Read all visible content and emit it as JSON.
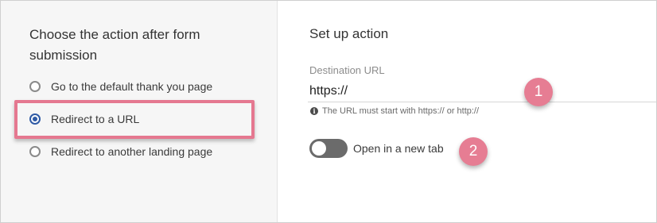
{
  "left_panel": {
    "title": "Choose the action after form submission",
    "options": [
      {
        "label": "Go to the default thank you page",
        "selected": false
      },
      {
        "label": "Redirect to a URL",
        "selected": true
      },
      {
        "label": "Redirect to another landing page",
        "selected": false
      }
    ]
  },
  "right_panel": {
    "title": "Set up action",
    "destination_label": "Destination URL",
    "destination_value": "https://",
    "helper_text": "The URL must start with https:// or http://",
    "toggle_label": "Open in a new tab",
    "toggle_on": false
  },
  "callouts": [
    "1",
    "2"
  ],
  "colors": {
    "accent": "#2f5aa5",
    "highlight": "#e57890",
    "callout": "#e67d93"
  }
}
